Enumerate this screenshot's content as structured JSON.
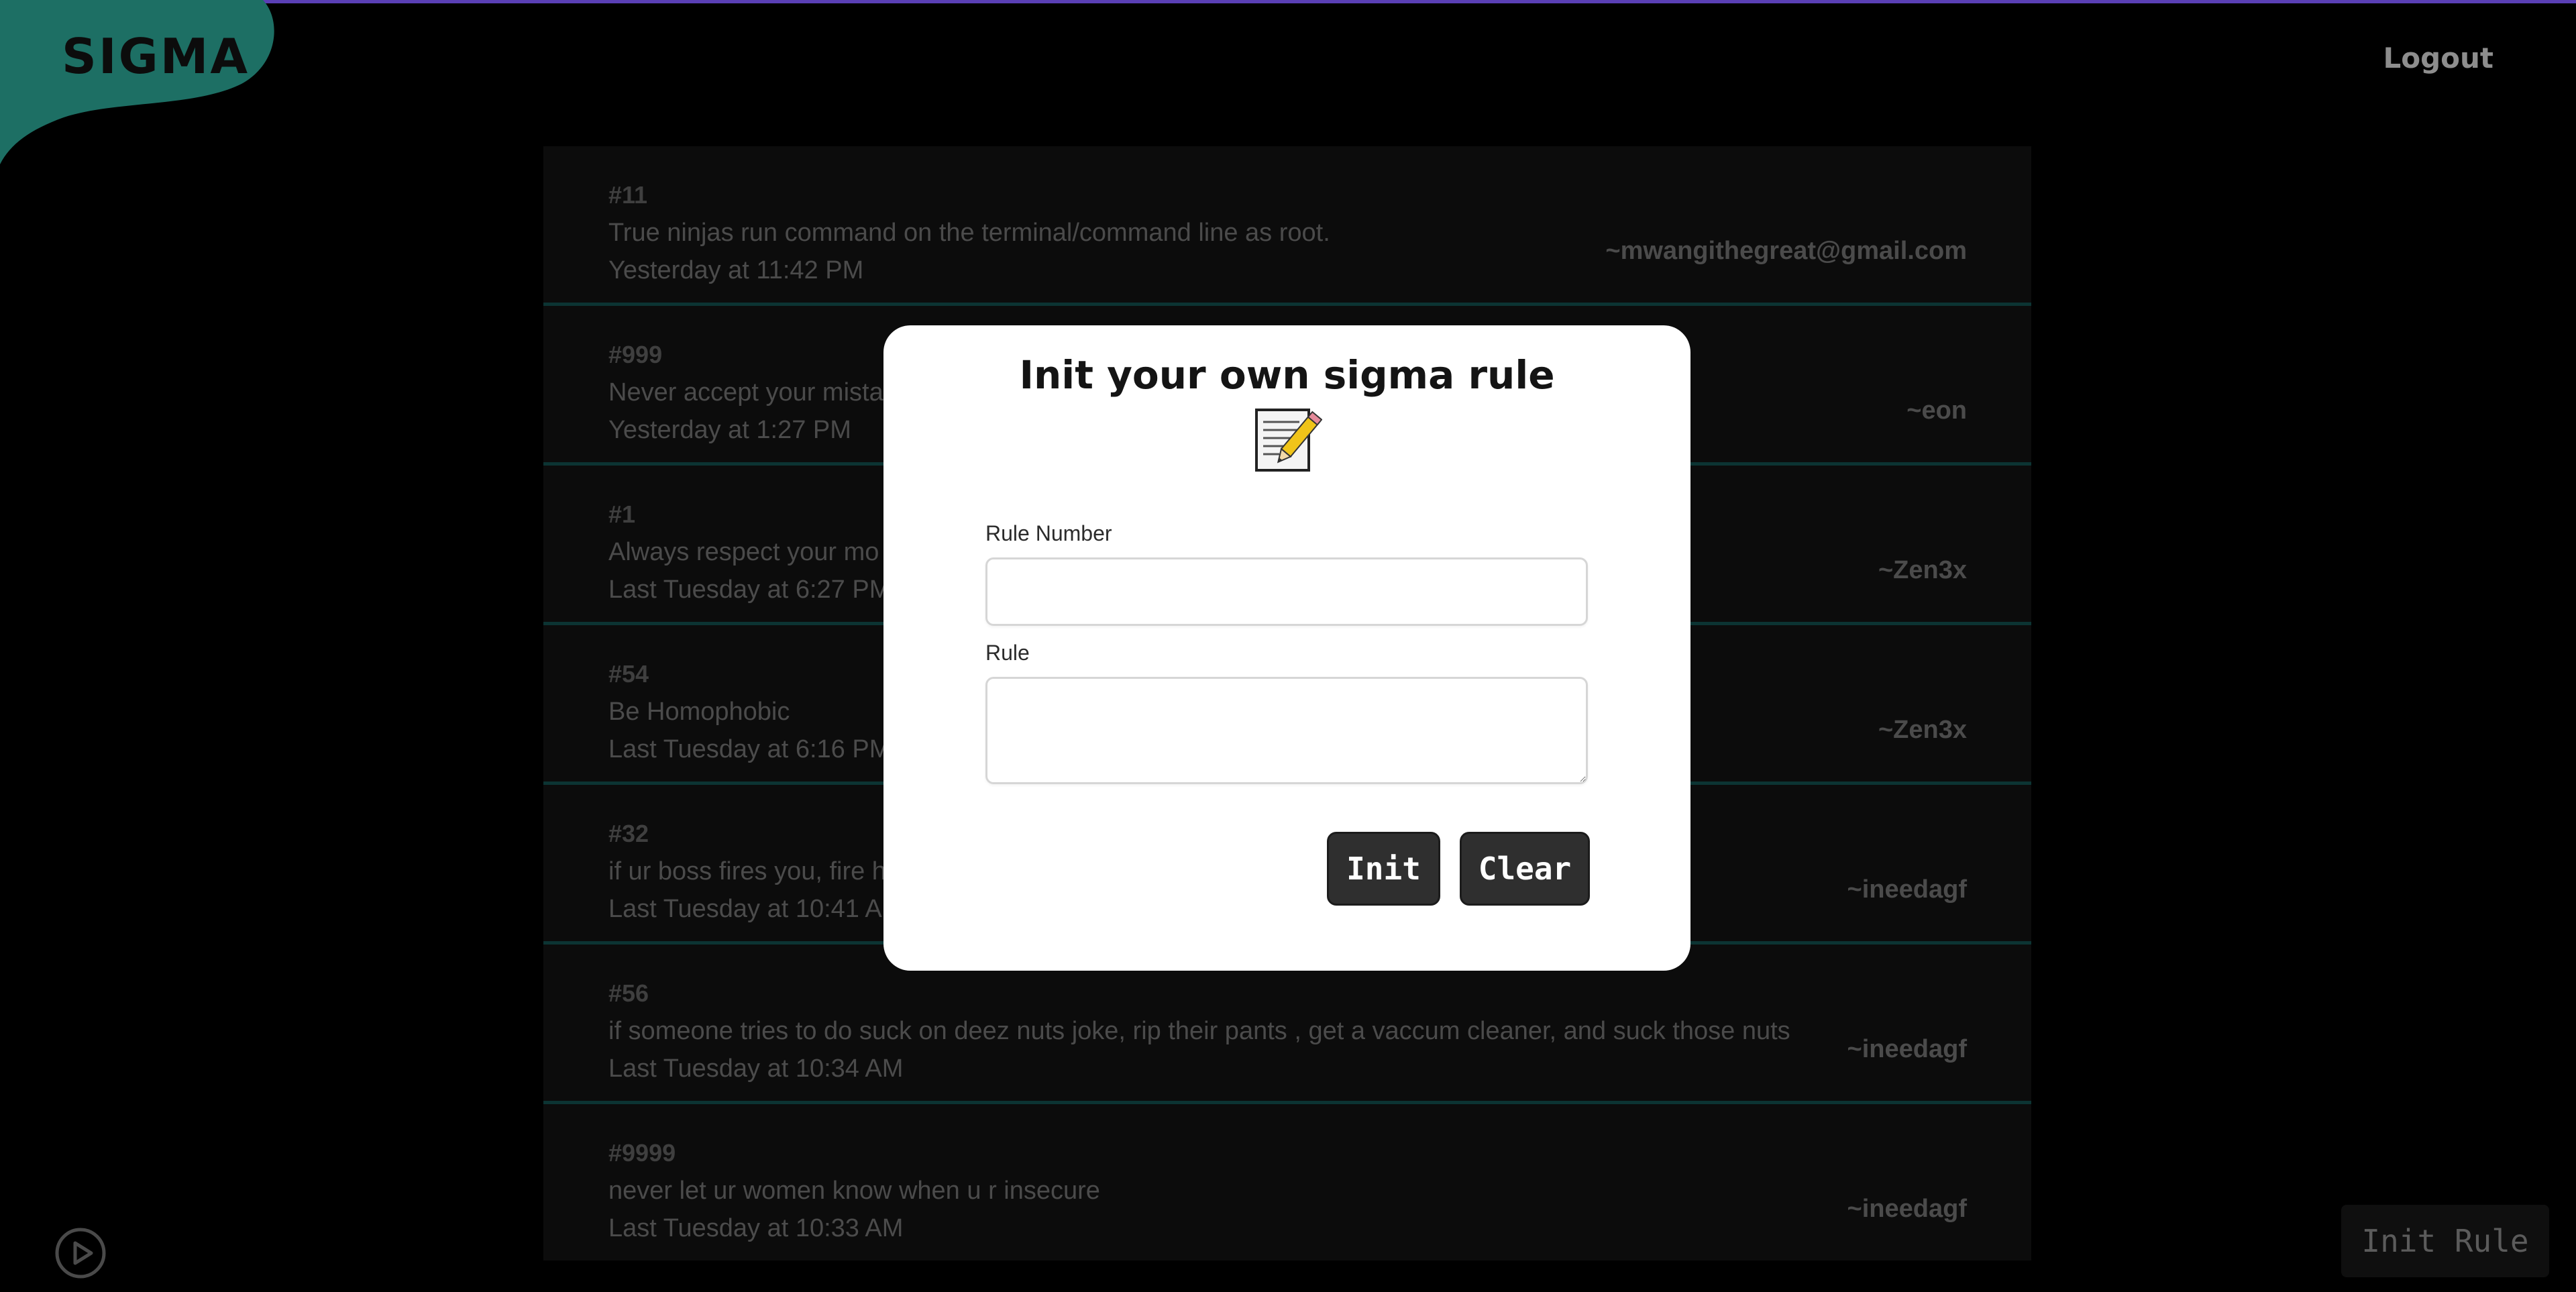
{
  "app": {
    "logo_text": "SIGMA",
    "logout_label": "Logout",
    "accent_color": "#1d6f64",
    "top_strip_color": "#5a3fb5"
  },
  "rules": [
    {
      "number": "#11",
      "text": "True ninjas run command on the terminal/command line as root.",
      "time": "Yesterday at 11:42 PM",
      "author": "~mwangithegreat@gmail.com"
    },
    {
      "number": "#999",
      "text": "Never accept your mista",
      "time": "Yesterday at 1:27 PM",
      "author": "~eon"
    },
    {
      "number": "#1",
      "text": "Always respect your mo",
      "time": "Last Tuesday at 6:27 PM",
      "author": "~Zen3x"
    },
    {
      "number": "#54",
      "text": "Be Homophobic",
      "time": "Last Tuesday at 6:16 PM",
      "author": "~Zen3x"
    },
    {
      "number": "#32",
      "text": "if ur boss fires you, fire h",
      "time": "Last Tuesday at 10:41 A",
      "author": "~ineedagf"
    },
    {
      "number": "#56",
      "text": "if someone tries to do suck on deez nuts joke, rip their pants , get a vaccum cleaner, and suck those nuts",
      "time": "Last Tuesday at 10:34 AM",
      "author": "~ineedagf"
    },
    {
      "number": "#9999",
      "text": "never let ur women know when u r insecure",
      "time": "Last Tuesday at 10:33 AM",
      "author": "~ineedagf"
    }
  ],
  "modal": {
    "title": "Init your own sigma rule",
    "icon": "memo-icon",
    "rule_number_label": "Rule Number",
    "rule_number_value": "",
    "rule_label": "Rule",
    "rule_value": "",
    "init_label": "Init",
    "clear_label": "Clear"
  },
  "footer": {
    "init_rule_label": "Init Rule",
    "play_icon": "play-icon"
  }
}
